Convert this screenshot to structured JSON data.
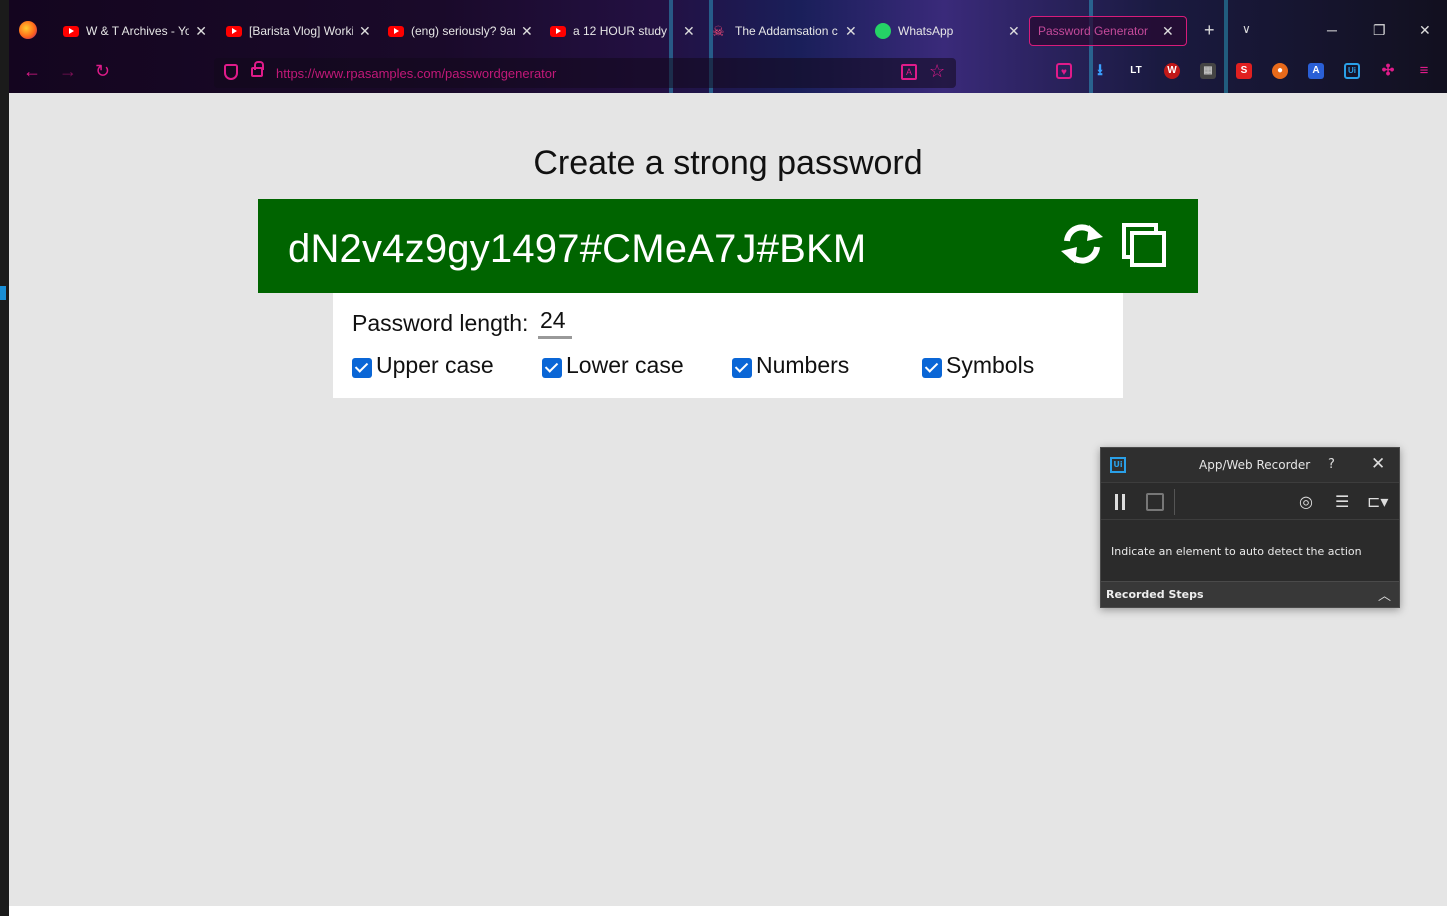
{
  "browser": {
    "tabs": [
      {
        "title": "W & T Archives - Yo",
        "icon": "youtube-icon"
      },
      {
        "title": "[Barista Vlog] Worki",
        "icon": "youtube-icon"
      },
      {
        "title": "(eng) seriously? 9am",
        "icon": "youtube-icon"
      },
      {
        "title": "a 12 HOUR study",
        "icon": "youtube-icon"
      },
      {
        "title": "The Addamsation c",
        "icon": "skull-icon"
      },
      {
        "title": "WhatsApp",
        "icon": "whatsapp-icon"
      },
      {
        "title": "Password Generator",
        "icon": "none",
        "active": true
      }
    ],
    "new_tab_label": "+",
    "list_all_label": "∨",
    "url": "https://www.rpasamples.com/passwordgenerator",
    "accent_color": "#e01b8a"
  },
  "page": {
    "heading": "Create a strong password",
    "password": "dN2v4z9gy1497#CMeA7J#BKM",
    "length_label": "Password length:",
    "length_value": "24",
    "options": [
      {
        "label": "Upper case",
        "checked": true
      },
      {
        "label": "Lower case",
        "checked": true
      },
      {
        "label": "Numbers",
        "checked": true
      },
      {
        "label": "Symbols",
        "checked": true
      }
    ],
    "password_bg": "#006400",
    "checkbox_color": "#0a66d6"
  },
  "recorder": {
    "logo": "Ui",
    "title": "App/Web Recorder",
    "help": "?",
    "close": "✕",
    "message": "Indicate an element to auto detect the action",
    "steps_label": "Recorded Steps"
  }
}
